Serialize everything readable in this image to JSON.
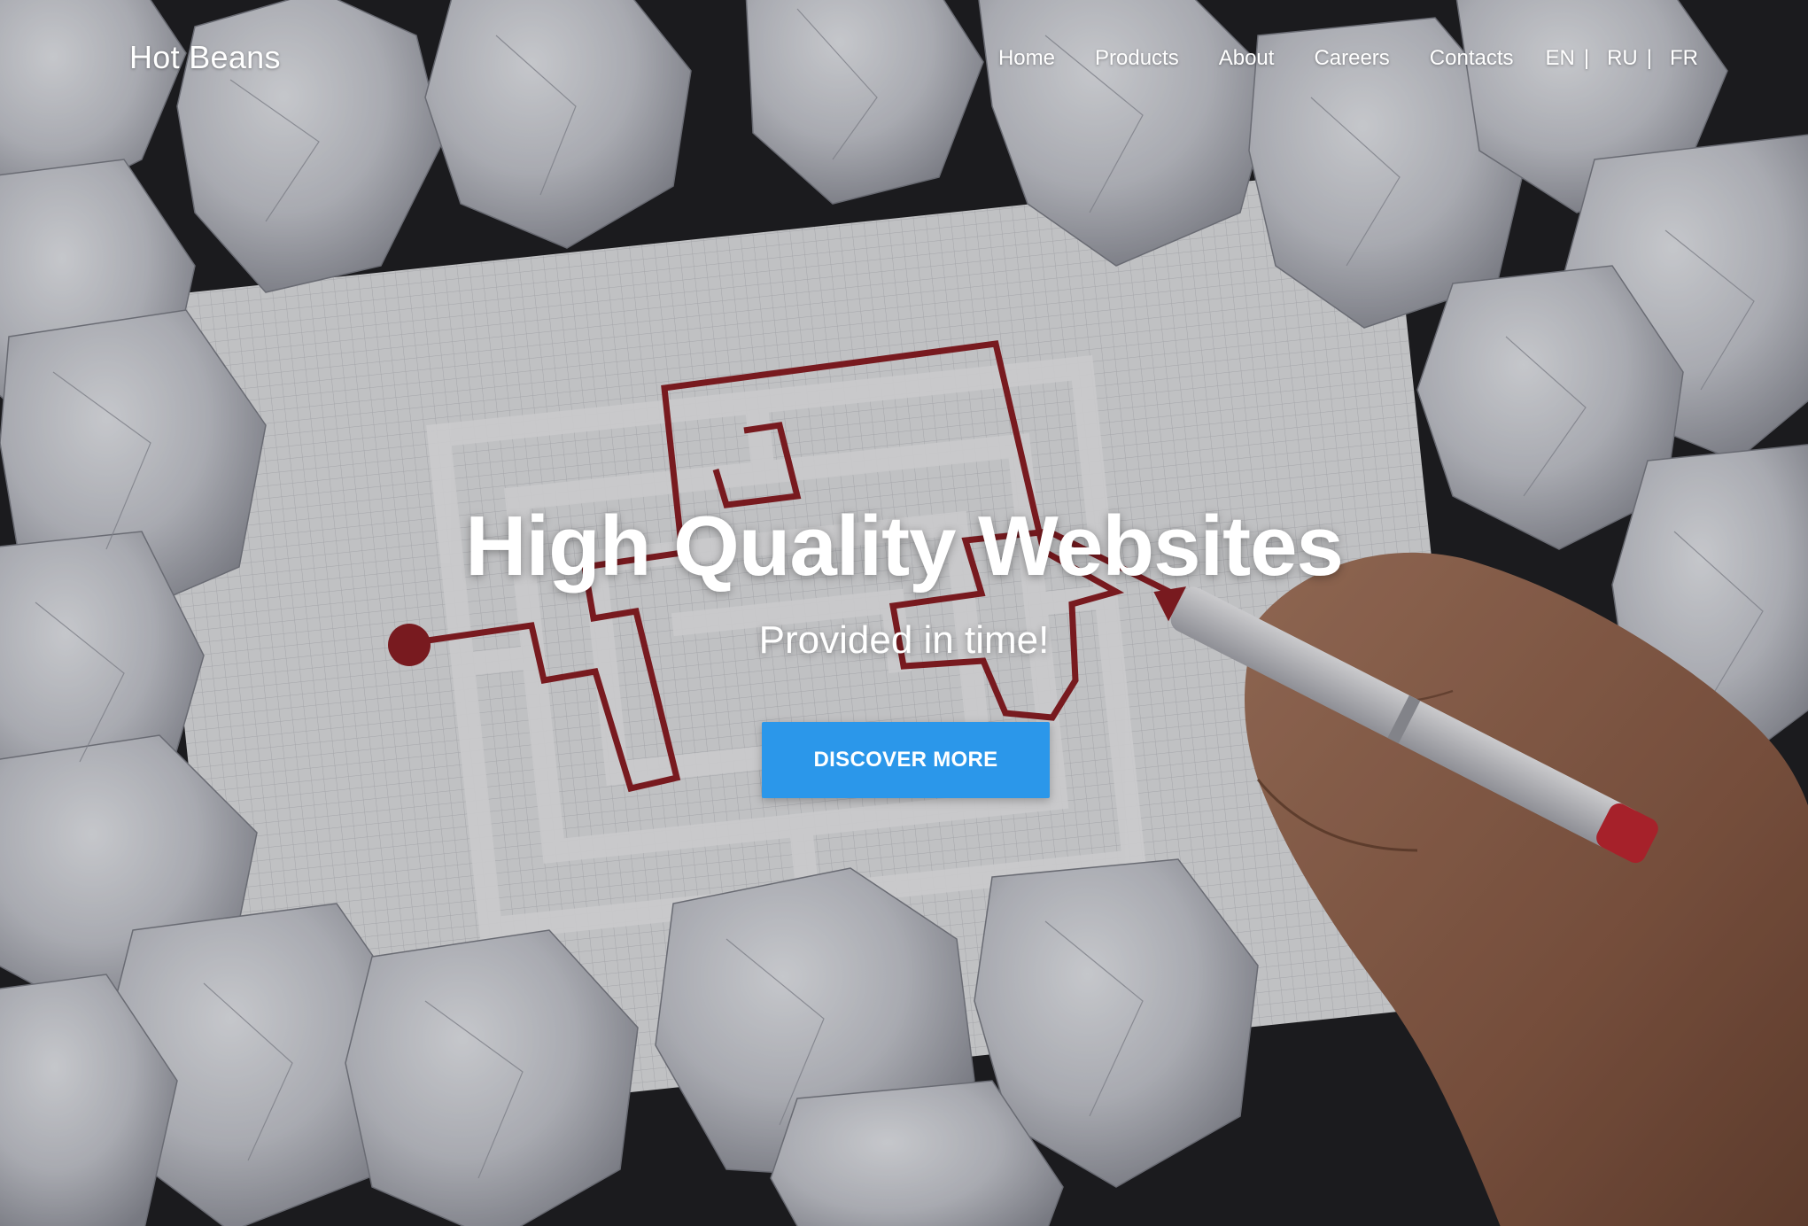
{
  "brand": {
    "name": "Hot Beans"
  },
  "nav": {
    "items": [
      {
        "label": "Home"
      },
      {
        "label": "Products"
      },
      {
        "label": "About"
      },
      {
        "label": "Careers"
      },
      {
        "label": "Contacts"
      }
    ],
    "languages": [
      {
        "code": "EN"
      },
      {
        "code": "RU"
      },
      {
        "code": "FR"
      }
    ]
  },
  "hero": {
    "headline": "High Quality Websites",
    "subheadline": "Provided in time!",
    "cta_label": "DISCOVER MORE",
    "background_image": "hand drawing red path through grid maze surrounded by crumpled paper balls",
    "colors": {
      "cta": "#2b97ea",
      "maze_path": "#8e1b22"
    }
  }
}
